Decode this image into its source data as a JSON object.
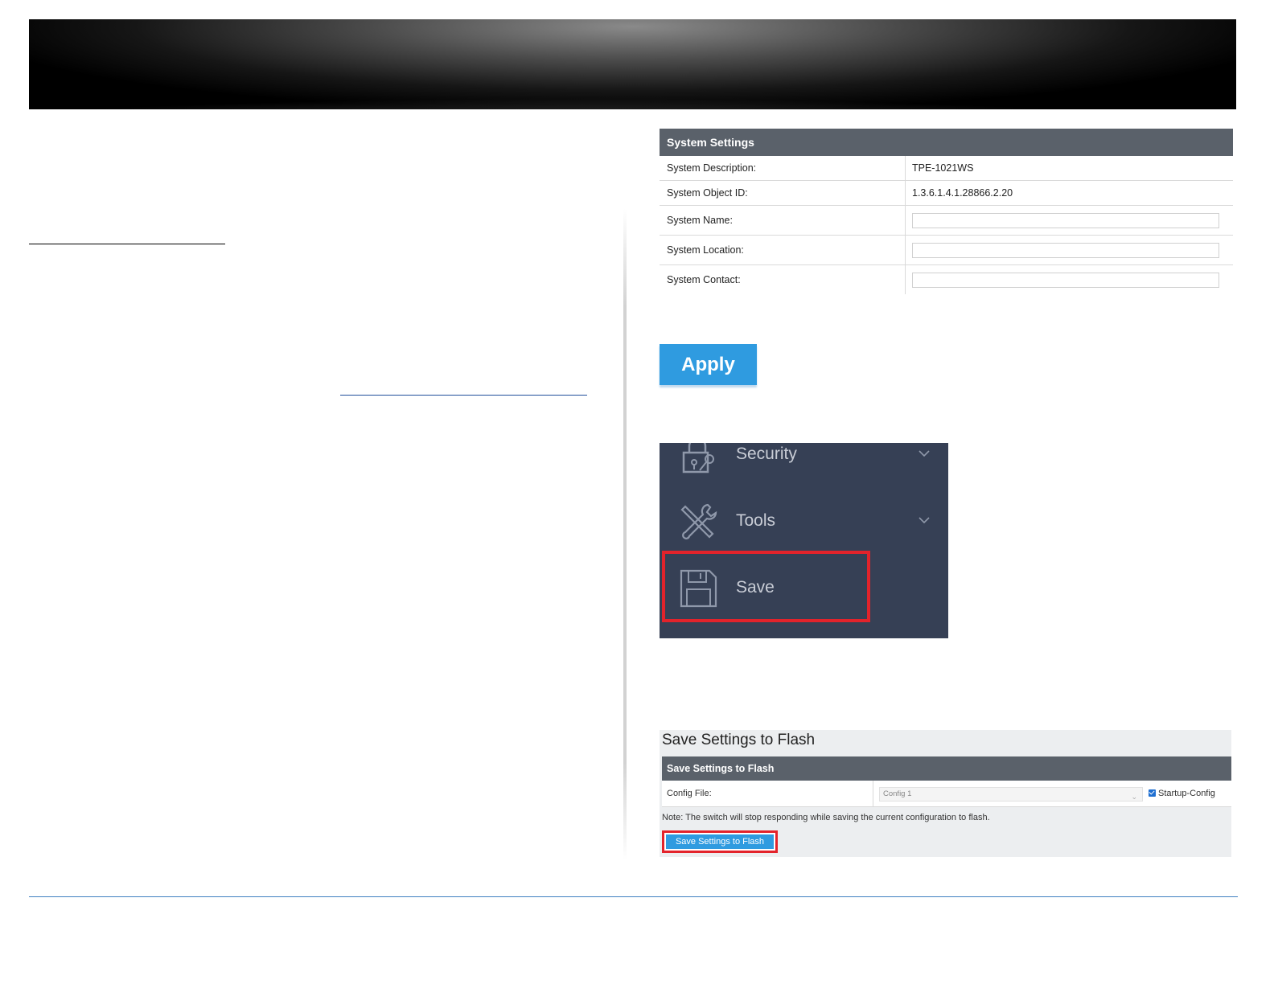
{
  "system_settings": {
    "header": "System Settings",
    "rows": [
      {
        "label": "System Description:",
        "value": "TPE-1021WS"
      },
      {
        "label": "System Object ID:",
        "value": "1.3.6.1.4.1.28866.2.20"
      },
      {
        "label": "System Name:",
        "value": ""
      },
      {
        "label": "System Location:",
        "value": ""
      },
      {
        "label": "System Contact:",
        "value": ""
      }
    ]
  },
  "apply_button": {
    "label": "Apply"
  },
  "menu": {
    "items": [
      {
        "label": "Security",
        "icon": "lock-icon"
      },
      {
        "label": "Tools",
        "icon": "tools-icon"
      },
      {
        "label": "Save",
        "icon": "floppy-disk-icon"
      }
    ],
    "highlight_color": "#e3232b"
  },
  "save_flash": {
    "title": "Save Settings to Flash",
    "header": "Save Settings to Flash",
    "config_label": "Config File:",
    "config_value": "Config 1",
    "checkbox_label": "Startup-Config",
    "checkbox_checked": true,
    "note": "Note: The switch will stop responding while saving the current configuration to flash.",
    "button_label": "Save Settings to Flash"
  },
  "colors": {
    "panel_header": "#5a616a",
    "button_blue": "#2f9be0",
    "menu_bg": "#364055"
  }
}
